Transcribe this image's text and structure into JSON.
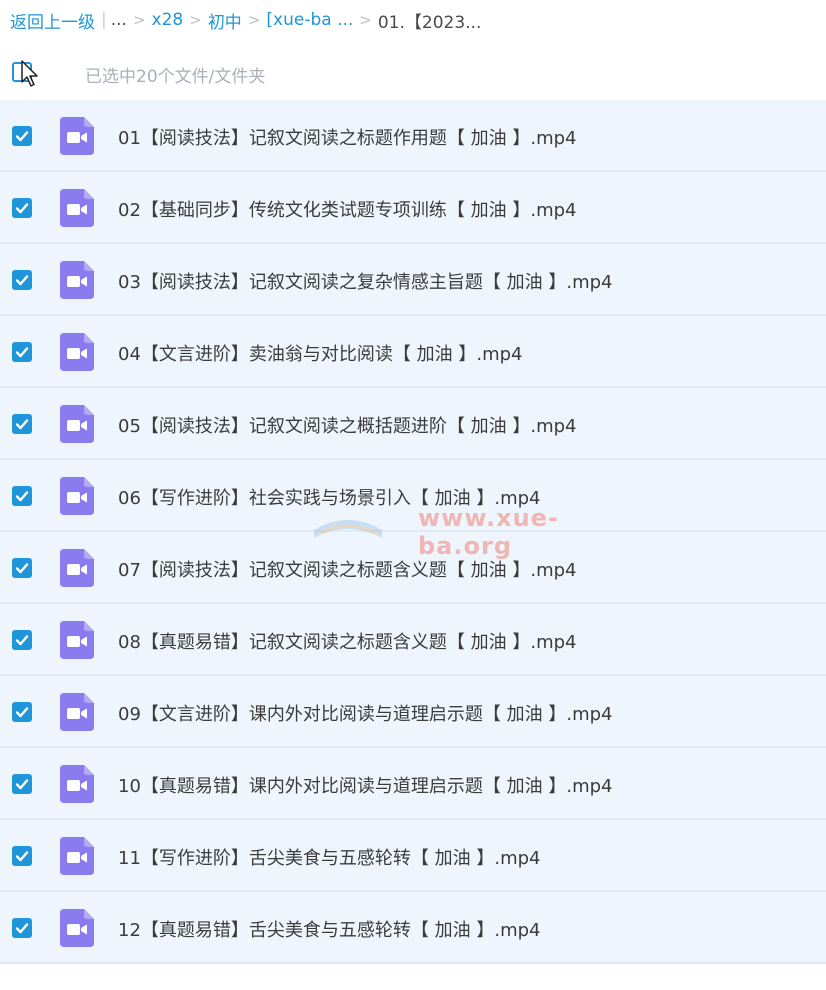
{
  "breadcrumb": {
    "back": "返回上一级",
    "ellipsis": "...",
    "items": [
      "x28",
      "初中",
      "[xue-ba ..."
    ],
    "current": "01.【2023..."
  },
  "selection": {
    "count_text": "已选中20个文件/文件夹"
  },
  "files": [
    {
      "name": "01【阅读技法】记叙文阅读之标题作用题【 加油 】.mp4"
    },
    {
      "name": "02【基础同步】传统文化类试题专项训练【 加油 】.mp4"
    },
    {
      "name": "03【阅读技法】记叙文阅读之复杂情感主旨题【 加油 】.mp4"
    },
    {
      "name": "04【文言进阶】卖油翁与对比阅读【 加油 】.mp4"
    },
    {
      "name": "05【阅读技法】记叙文阅读之概括题进阶【 加油 】.mp4"
    },
    {
      "name": "06【写作进阶】社会实践与场景引入【 加油 】.mp4"
    },
    {
      "name": "07【阅读技法】记叙文阅读之标题含义题【 加油 】.mp4"
    },
    {
      "name": "08【真题易错】记叙文阅读之标题含义题【 加油 】.mp4"
    },
    {
      "name": "09【文言进阶】课内外对比阅读与道理启示题【 加油 】.mp4"
    },
    {
      "name": "10【真题易错】课内外对比阅读与道理启示题【 加油 】.mp4"
    },
    {
      "name": "11【写作进阶】舌尖美食与五感轮转【 加油 】.mp4"
    },
    {
      "name": "12【真题易错】舌尖美食与五感轮转【 加油 】.mp4"
    }
  ],
  "watermark": {
    "text": "www.xue-ba.org"
  },
  "colors": {
    "accent": "#1e96d8",
    "icon": "#8a7cf0",
    "row_bg": "#eef5fc"
  }
}
